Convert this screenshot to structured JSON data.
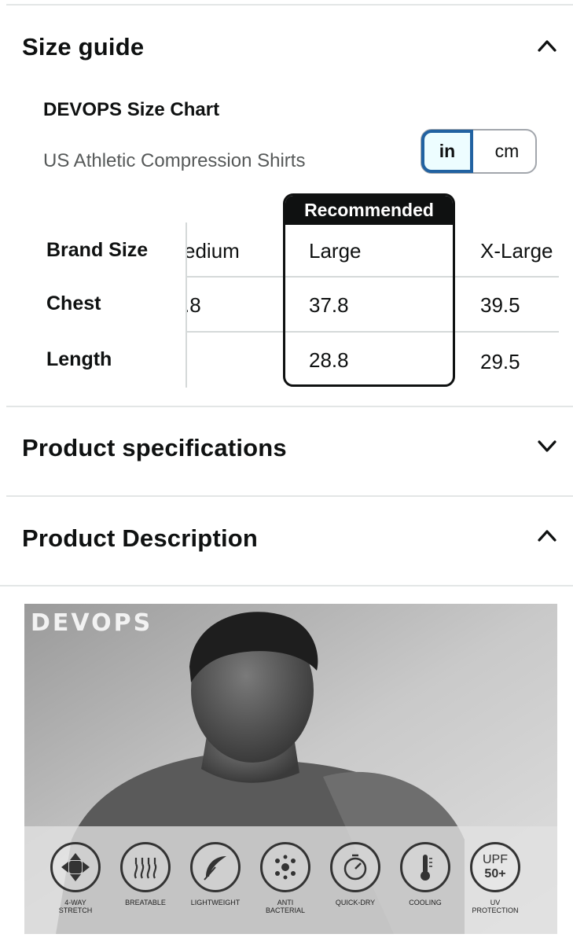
{
  "size_guide": {
    "title": "Size guide",
    "chart_title": "DEVOPS Size Chart",
    "subtitle": "US Athletic Compression Shirts",
    "unit_toggle": {
      "in": "in",
      "cm": "cm",
      "selected": "in"
    },
    "recommended_label": "Recommended",
    "row_labels": [
      "Brand Size",
      "Chest",
      "Length"
    ],
    "columns": [
      {
        "size": "edium",
        "chest": ".8",
        "length": ""
      },
      {
        "size": "Large",
        "chest": "37.8",
        "length": "28.8",
        "recommended": true
      },
      {
        "size": "X-Large",
        "chest": "39.5",
        "length": "29.5"
      }
    ]
  },
  "product_specifications": {
    "title": "Product specifications"
  },
  "product_description": {
    "title": "Product Description",
    "image": {
      "brand_logo": "DEVOPS",
      "features": [
        {
          "icon": "four-way-arrows-icon",
          "label": "4-WAY\nSTRETCH"
        },
        {
          "icon": "breathable-waves-icon",
          "label": "BREATABLE"
        },
        {
          "icon": "feather-icon",
          "label": "LIGHTWEIGHT"
        },
        {
          "icon": "antibacterial-icon",
          "label": "ANTI\nBACTERIAL"
        },
        {
          "icon": "stopwatch-icon",
          "label": "QUICK-DRY"
        },
        {
          "icon": "thermometer-icon",
          "label": "COOLING"
        },
        {
          "icon": "upf-badge-icon",
          "label": "UV\nPROTECTION",
          "badge_line1": "UPF",
          "badge_line2": "50+"
        }
      ]
    }
  }
}
